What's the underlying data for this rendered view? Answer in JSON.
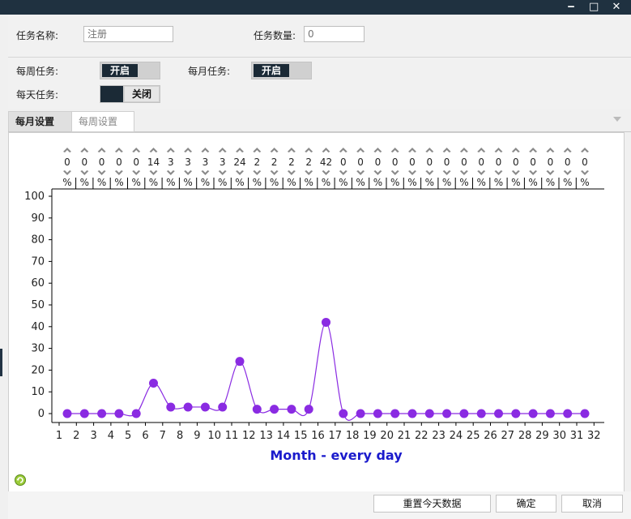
{
  "window": {
    "title": "",
    "minimize_glyph": "‒",
    "maximize_glyph": "□",
    "close_glyph": "✕"
  },
  "form": {
    "task_name_label": "任务名称:",
    "task_name_placeholder": "注册",
    "task_count_label": "任务数量:",
    "task_count_placeholder": "0",
    "weekly_label": "每周任务:",
    "weekly_toggle": "开启",
    "monthly_label": "每月任务:",
    "monthly_toggle": "开启",
    "daily_label": "每天任务:",
    "daily_toggle": "关闭"
  },
  "tabs": {
    "monthly": "每月设置",
    "weekly": "每周设置"
  },
  "buttons": {
    "reset": "重置今天数据",
    "ok": "确定",
    "cancel": "取消"
  },
  "colors": {
    "series": "#8a2be2",
    "xlabel": "#1a1acc",
    "titlebar": "#1f3140"
  },
  "chart_data": {
    "type": "line",
    "xlabel": "Month - every day",
    "ylabel": "",
    "ylim": [
      0,
      100
    ],
    "yticks": [
      0,
      10,
      20,
      30,
      40,
      50,
      60,
      70,
      80,
      90,
      100
    ],
    "xticks": [
      1,
      2,
      3,
      4,
      5,
      6,
      7,
      8,
      9,
      10,
      11,
      12,
      13,
      14,
      15,
      16,
      17,
      18,
      19,
      20,
      21,
      22,
      23,
      24,
      25,
      26,
      27,
      28,
      29,
      30,
      31,
      32
    ],
    "percent_sign": "%",
    "days": [
      1,
      2,
      3,
      4,
      5,
      6,
      7,
      8,
      9,
      10,
      11,
      12,
      13,
      14,
      15,
      16,
      17,
      18,
      19,
      20,
      21,
      22,
      23,
      24,
      25,
      26,
      27,
      28,
      29,
      30,
      31
    ],
    "values": [
      0,
      0,
      0,
      0,
      0,
      14,
      3,
      3,
      3,
      3,
      24,
      2,
      2,
      2,
      2,
      42,
      0,
      0,
      0,
      0,
      0,
      0,
      0,
      0,
      0,
      0,
      0,
      0,
      0,
      0,
      0
    ],
    "grid": false
  }
}
